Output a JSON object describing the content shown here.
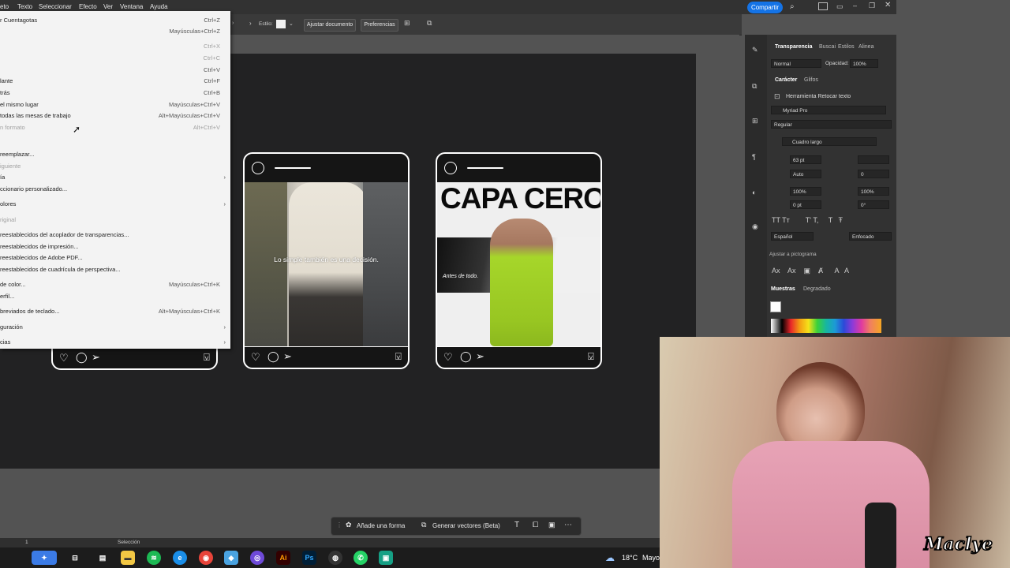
{
  "menubar": {
    "items": [
      "eto",
      "Texto",
      "Seleccionar",
      "Efecto",
      "Ver",
      "Ventana",
      "Ayuda"
    ],
    "share_label": "Compartir"
  },
  "controlbar": {
    "style_label": "Estilo:",
    "fit_doc": "Ajustar documento",
    "prefs": "Preferencias"
  },
  "menu": {
    "rows": [
      {
        "label": "r Cuentagotas",
        "shortcut": "Ctrl+Z",
        "dim": false,
        "sub": false
      },
      {
        "label": "",
        "shortcut": "Mayúsculas+Ctrl+Z",
        "dim": false,
        "sub": false
      },
      {
        "label": "",
        "shortcut": "Ctrl+X",
        "dim": true,
        "sub": false
      },
      {
        "label": "",
        "shortcut": "Ctrl+C",
        "dim": true,
        "sub": false
      },
      {
        "label": "",
        "shortcut": "Ctrl+V",
        "dim": false,
        "sub": false
      },
      {
        "label": "lante",
        "shortcut": "Ctrl+F",
        "dim": false,
        "sub": false
      },
      {
        "label": "trás",
        "shortcut": "Ctrl+B",
        "dim": false,
        "sub": false
      },
      {
        "label": "el mismo lugar",
        "shortcut": "Mayúsculas+Ctrl+V",
        "dim": false,
        "sub": false
      },
      {
        "label": "todas las mesas de trabajo",
        "shortcut": "Alt+Mayúsculas+Ctrl+V",
        "dim": false,
        "sub": false
      },
      {
        "label": "n formato",
        "shortcut": "Alt+Ctrl+V",
        "dim": true,
        "sub": false
      },
      {
        "label": "reemplazar...",
        "shortcut": "",
        "dim": false,
        "sub": false
      },
      {
        "label": "iguiente",
        "shortcut": "",
        "dim": true,
        "sub": false
      },
      {
        "label": "ía",
        "shortcut": "",
        "dim": false,
        "sub": true
      },
      {
        "label": "ccionario personalizado...",
        "shortcut": "",
        "dim": false,
        "sub": false
      },
      {
        "label": "olores",
        "shortcut": "",
        "dim": false,
        "sub": true
      },
      {
        "label": "riginal",
        "shortcut": "",
        "dim": true,
        "sub": false
      },
      {
        "label": "reestablecidos del acoplador de transparencias...",
        "shortcut": "",
        "dim": false,
        "sub": false
      },
      {
        "label": "reestablecidos de impresión...",
        "shortcut": "",
        "dim": false,
        "sub": false
      },
      {
        "label": "reestablecidos de Adobe PDF...",
        "shortcut": "",
        "dim": false,
        "sub": false
      },
      {
        "label": "reestablecidos de cuadrícula de perspectiva...",
        "shortcut": "",
        "dim": false,
        "sub": false
      },
      {
        "label": "de color...",
        "shortcut": "Mayúsculas+Ctrl+K",
        "dim": false,
        "sub": false
      },
      {
        "label": "erfil...",
        "shortcut": "",
        "dim": false,
        "sub": false
      },
      {
        "label": "breviados de teclado...",
        "shortcut": "Alt+Mayúsculas+Ctrl+K",
        "dim": false,
        "sub": false
      },
      {
        "label": "guración",
        "shortcut": "",
        "dim": false,
        "sub": true
      },
      {
        "label": "cias",
        "shortcut": "",
        "dim": false,
        "sub": true
      }
    ]
  },
  "cards": [
    {
      "overlay_text": "",
      "headline": "",
      "caption": ""
    },
    {
      "overlay_text": "Lo simple también es una decisión.",
      "headline": "",
      "caption": ""
    },
    {
      "overlay_text": "",
      "headline": "CAPA CERO",
      "caption": "Antes de todo."
    }
  ],
  "panel": {
    "tabs_top": [
      "Transparencia",
      "Buscai",
      "Estilos",
      "Alinea"
    ],
    "blend_mode": "Normal",
    "opacity_label": "Opacidad:",
    "opacity_value": "100%",
    "char_tabs": [
      "Carácter",
      "Glifos"
    ],
    "touch_type": "Herramienta Retocar texto",
    "font_family": "Myriad Pro",
    "font_style": "Regular",
    "frame": "Cuadro largo",
    "size": "63 pt",
    "leading": "",
    "kerning": "Auto",
    "tracking": "0",
    "vscale": "100%",
    "hscale": "100%",
    "baseline": "0 pt",
    "rotation": "0°",
    "language": "Español",
    "antialias": "Enfocado",
    "snap_label": "Ajustar a pictograma",
    "swatch_tabs": [
      "Muestras",
      "Degradado"
    ]
  },
  "floatbar": {
    "add_shape": "Añade una forma",
    "gen_vectors": "Generar vectores (Beta)"
  },
  "statusbar": {
    "zoom": "1",
    "tool": "Selección"
  },
  "taskbar": {
    "weather": "18°C",
    "weather_word": "Mayo"
  },
  "webcam": {
    "watermark": "Maclye"
  },
  "colors": {
    "accent": "#1473e6",
    "hoodie_green": "#a6d62a"
  }
}
